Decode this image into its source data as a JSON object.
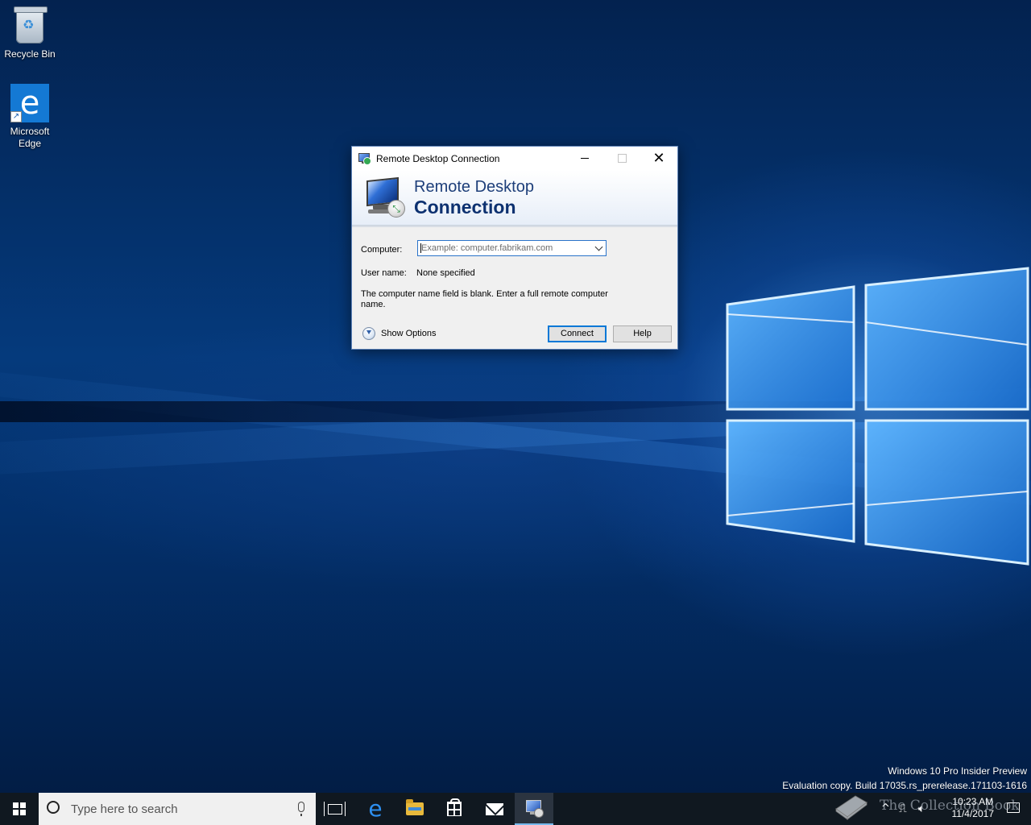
{
  "desktop": {
    "icons": [
      {
        "label": "Recycle Bin",
        "icon": "recycle-bin-icon"
      },
      {
        "label": "Microsoft\nEdge",
        "icon": "edge-icon"
      }
    ],
    "watermark": {
      "line1": "Windows 10 Pro Insider Preview",
      "line2": "Evaluation copy. Build 17035.rs_prerelease.171103-1616"
    },
    "overlay_text": "The Collection Book"
  },
  "dialog": {
    "title": "Remote Desktop Connection",
    "banner_line1": "Remote Desktop",
    "banner_line2": "Connection",
    "computer_label": "Computer:",
    "computer_value": "",
    "computer_placeholder": "Example: computer.fabrikam.com",
    "username_label": "User name:",
    "username_value": "None specified",
    "message": "The computer name field is blank. Enter a full remote computer name.",
    "show_options": "Show Options",
    "connect": "Connect",
    "help": "Help"
  },
  "taskbar": {
    "search_placeholder": "Type here to search",
    "pinned": [
      "task-view-icon",
      "edge-icon",
      "file-explorer-icon",
      "store-icon",
      "mail-icon",
      "remote-desktop-icon"
    ],
    "clock_time": "10:23 AM",
    "clock_date": "11/4/2017"
  },
  "colors": {
    "accent": "#0078d7",
    "taskbar": "#101820",
    "banner_text": "#0d3170"
  }
}
